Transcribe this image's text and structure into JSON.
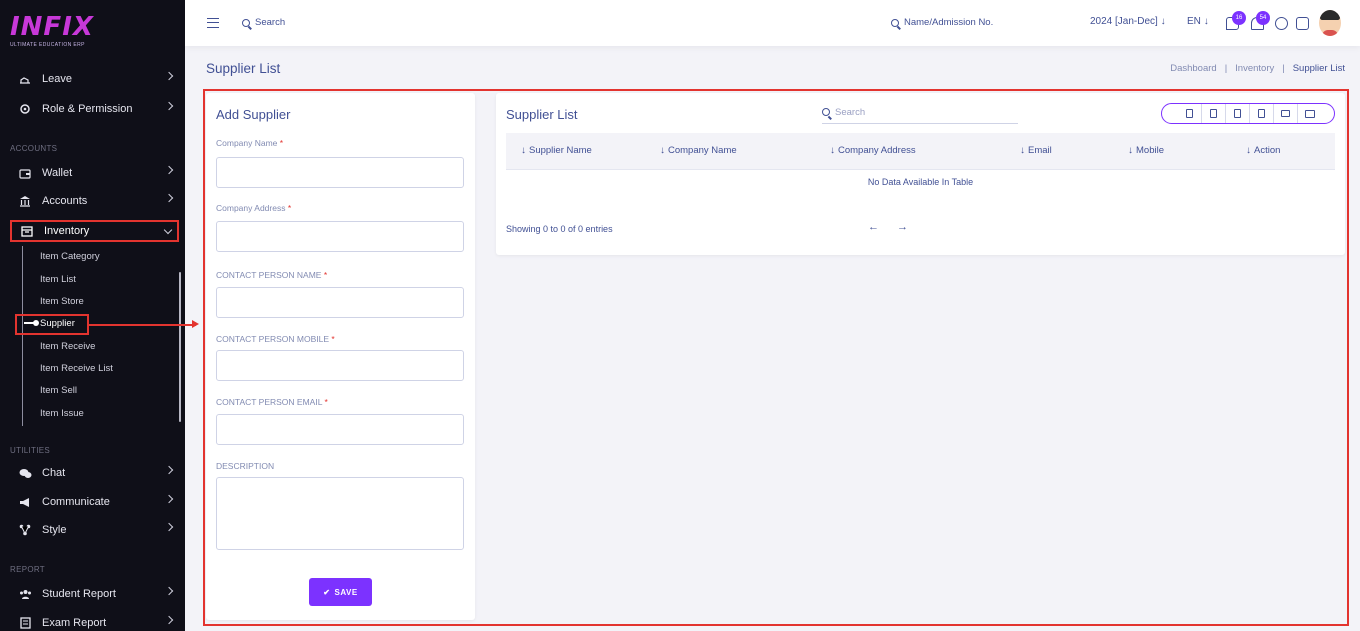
{
  "brand": {
    "logo_text": "INFIX",
    "tagline": "ULTIMATE EDUCATION ERP"
  },
  "sidebar": {
    "items_top": [
      {
        "label": "Leave",
        "icon": "leave-icon"
      },
      {
        "label": "Role & Permission",
        "icon": "role-icon"
      }
    ],
    "section_accounts": "ACCOUNTS",
    "items_accounts": [
      {
        "label": "Wallet",
        "icon": "wallet-icon"
      },
      {
        "label": "Accounts",
        "icon": "bank-icon"
      },
      {
        "label": "Inventory",
        "icon": "inventory-icon"
      }
    ],
    "inventory_sub": [
      "Item Category",
      "Item List",
      "Item Store",
      "Supplier",
      "Item Receive",
      "Item Receive List",
      "Item Sell",
      "Item Issue"
    ],
    "section_utilities": "UTILITIES",
    "items_utilities": [
      {
        "label": "Chat",
        "icon": "chat-icon"
      },
      {
        "label": "Communicate",
        "icon": "megaphone-icon"
      },
      {
        "label": "Style",
        "icon": "style-icon"
      }
    ],
    "section_report": "REPORT",
    "items_report": [
      {
        "label": "Student Report",
        "icon": "students-icon"
      },
      {
        "label": "Exam Report",
        "icon": "exam-icon"
      }
    ]
  },
  "topbar": {
    "search_placeholder": "Search",
    "admission_search": "Name/Admission No.",
    "session": "2024 [Jan-Dec]",
    "language": "EN",
    "messages_count": "16",
    "notifications_count": "54"
  },
  "page": {
    "title": "Supplier List",
    "breadcrumb": [
      "Dashboard",
      "Inventory",
      "Supplier List"
    ]
  },
  "form": {
    "title": "Add Supplier",
    "fields": [
      {
        "label": "Company Name",
        "required": "*"
      },
      {
        "label": "Company Address",
        "required": "*"
      },
      {
        "label": "CONTACT PERSON NAME",
        "required": "*"
      },
      {
        "label": "CONTACT PERSON MOBILE",
        "required": "*"
      },
      {
        "label": "CONTACT PERSON EMAIL",
        "required": "*"
      }
    ],
    "description_label": "DESCRIPTION",
    "save_label": "SAVE"
  },
  "list": {
    "title": "Supplier List",
    "search_placeholder": "Search",
    "columns": [
      "Supplier Name",
      "Company Name",
      "Company Address",
      "Email",
      "Mobile",
      "Action"
    ],
    "empty_text": "No Data Available In Table",
    "showing_text": "Showing 0 to 0 of 0 entries",
    "prev": "←",
    "next": "→"
  },
  "colors": {
    "accent": "#7c32ff",
    "highlight": "#e3342f",
    "text": "#415094",
    "sidebar_bg": "#0f0f18"
  }
}
